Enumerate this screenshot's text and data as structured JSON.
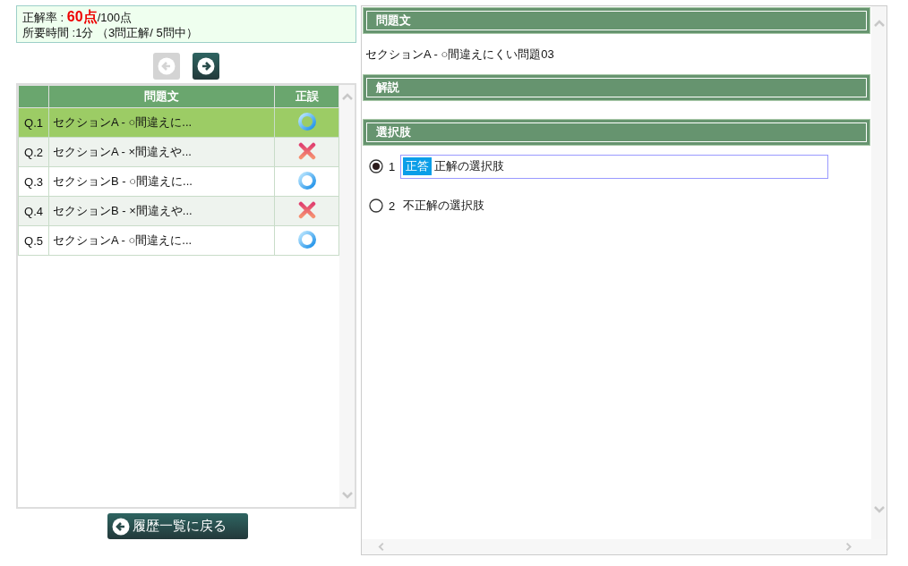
{
  "summary": {
    "score_label": "正解率 : ",
    "score": "60点",
    "score_total": "/100点",
    "time": "所要時間 :1分 （3問正解/ 5問中）"
  },
  "nav": {
    "prev": {
      "disabled": true
    },
    "next": {
      "disabled": false
    }
  },
  "table": {
    "columns": [
      "問題文",
      "正誤"
    ],
    "rows": [
      {
        "number": "Q.1",
        "text": "セクションA - ○間違えに...",
        "kind": "correct",
        "selected": true
      },
      {
        "number": "Q.2",
        "text": "セクションA - ×間違えや...",
        "kind": "wrong",
        "selected": false
      },
      {
        "number": "Q.3",
        "text": "セクションB - ○間違えに...",
        "kind": "correct",
        "selected": false
      },
      {
        "number": "Q.4",
        "text": "セクションB - ×間違えや...",
        "kind": "wrong",
        "selected": false
      },
      {
        "number": "Q.5",
        "text": "セクションA - ○間違えに...",
        "kind": "correct",
        "selected": false
      }
    ]
  },
  "back_button": "履歴一覧に戻る",
  "detail": {
    "question_heading": "問題文",
    "question_text": "セクションA - ○間違えにくい問題03",
    "explanation_heading": "解説",
    "choices_heading": "選択肢",
    "choices": [
      {
        "number": "1",
        "badge": "正答",
        "text": "正解の選択肢",
        "selected": true
      },
      {
        "number": "2",
        "text": "不正解の選択肢",
        "selected": false
      }
    ]
  }
}
